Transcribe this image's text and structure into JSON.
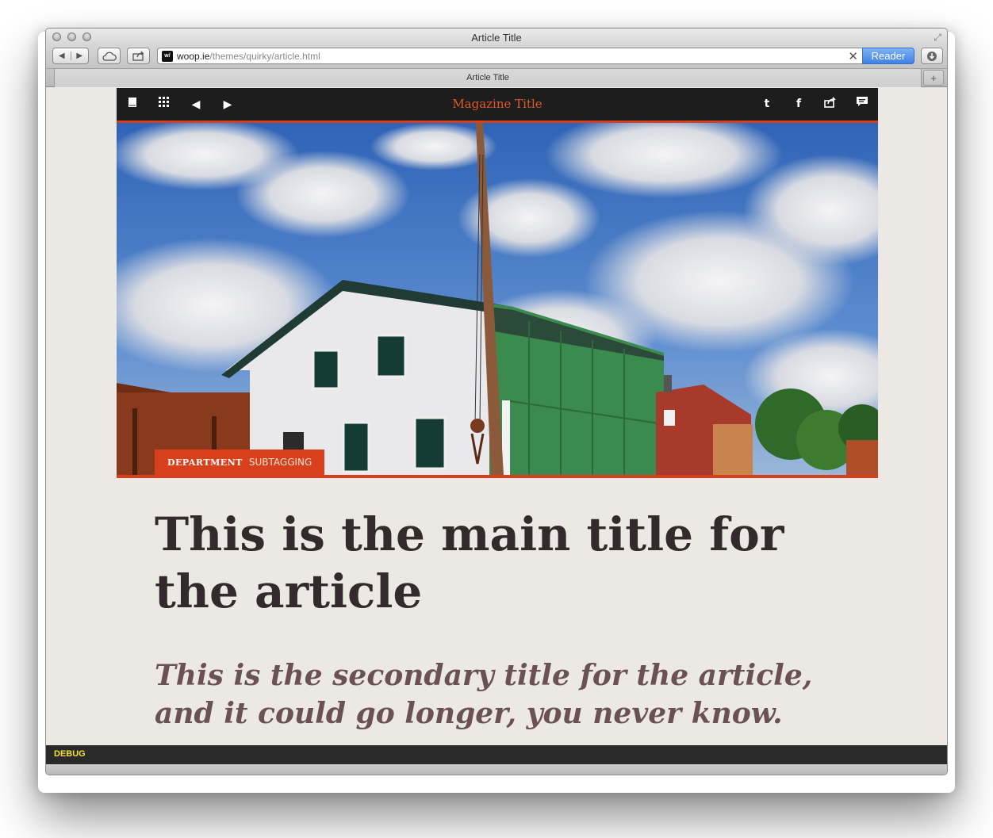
{
  "window": {
    "title": "Article Title"
  },
  "toolbar": {
    "back_icon": "back-arrow-icon",
    "forward_icon": "forward-arrow-icon",
    "icloud_icon": "cloud-icon",
    "share_icon": "share-icon",
    "url_domain": "woop.ie",
    "url_path": "/themes/quirky/article.html",
    "reader_label": "Reader",
    "download_icon": "download-icon"
  },
  "tab": {
    "title": "Article Title",
    "new_tab_label": "+"
  },
  "magazine": {
    "title": "Magazine Title",
    "left_icons": [
      "bookmark-icon",
      "grid-icon",
      "prev-icon",
      "next-icon"
    ],
    "right_icons": [
      "twitter-icon",
      "facebook-icon",
      "share-icon",
      "comment-icon"
    ],
    "accent_color": "#d7401a"
  },
  "hero": {
    "department": "DEPARTMENT",
    "subtagging": "SUBTAGGING"
  },
  "article": {
    "main_title": "This is the main title for the article",
    "secondary_title": "This is the secondary title for the article, and it could go longer, you never know."
  },
  "debug": {
    "label": "DEBUG"
  }
}
